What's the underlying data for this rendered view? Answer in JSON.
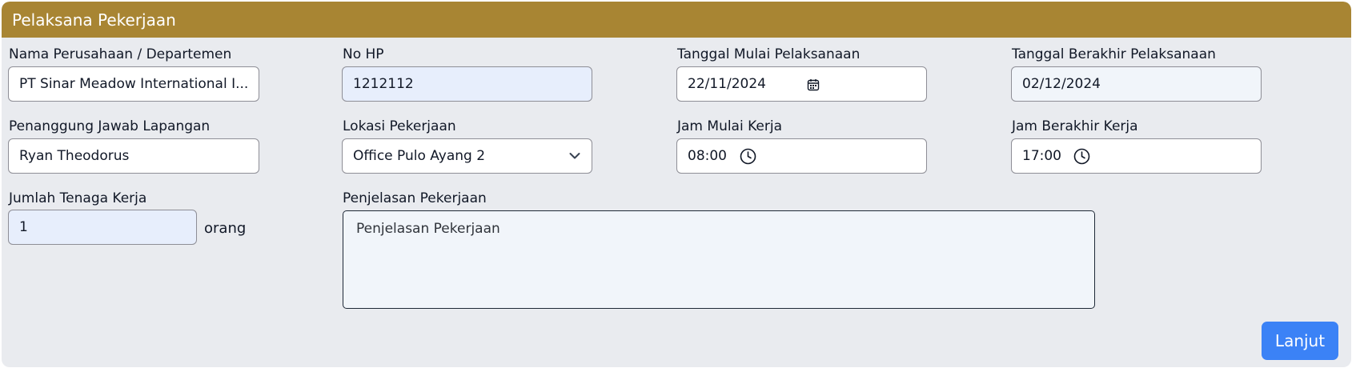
{
  "section": {
    "title": "Pelaksana Pekerjaan"
  },
  "fields": {
    "company": {
      "label": "Nama Perusahaan / Departemen",
      "value": "PT Sinar Meadow International I..."
    },
    "phone": {
      "label": "No HP",
      "value": "1212112"
    },
    "start_date": {
      "label": "Tanggal Mulai Pelaksanaan",
      "value": "22/11/2024"
    },
    "end_date": {
      "label": "Tanggal Berakhir Pelaksanaan",
      "value": "02/12/2024"
    },
    "field_pic": {
      "label": "Penanggung Jawab Lapangan",
      "value": "Ryan Theodorus"
    },
    "location": {
      "label": "Lokasi Pekerjaan",
      "value": "Office Pulo Ayang 2"
    },
    "start_time": {
      "label": "Jam Mulai Kerja",
      "value": "08:00"
    },
    "end_time": {
      "label": "Jam Berakhir Kerja",
      "value": "17:00"
    },
    "workers": {
      "label": "Jumlah Tenaga Kerja",
      "value": "1",
      "suffix": "orang"
    },
    "description": {
      "label": "Penjelasan Pekerjaan",
      "placeholder": "Penjelasan Pekerjaan"
    }
  },
  "actions": {
    "next_label": "Lanjut"
  },
  "icons": {
    "date": "calendar-icon",
    "time": "clock-icon",
    "select": "chevron-down-icon"
  },
  "colors": {
    "header": "#a88533",
    "panel": "#e9ebef",
    "button": "#3b82f6",
    "input_highlight": "#e7eefc"
  }
}
